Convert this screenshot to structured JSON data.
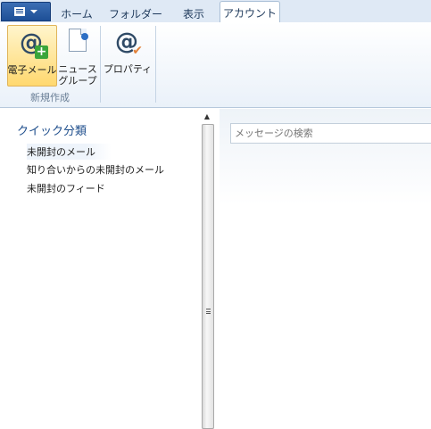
{
  "ribbon": {
    "file_menu_icon": "document-list-icon",
    "tabs": [
      {
        "label": "ホーム"
      },
      {
        "label": "フォルダー"
      },
      {
        "label": "表示"
      },
      {
        "label": "アカウント",
        "active": true
      }
    ],
    "buttons": {
      "email": {
        "label": "電子メール",
        "icon": "at-plus-icon",
        "selected": true
      },
      "newsgroup": {
        "label_line1": "ニュース",
        "label_line2": "グループ",
        "icon": "document-pin-icon"
      },
      "properties": {
        "label": "プロパティ",
        "icon": "at-check-icon"
      }
    },
    "group_label": "新規作成"
  },
  "sidebar": {
    "title": "クイック分類",
    "items": [
      {
        "label": "未開封のメール"
      },
      {
        "label": "知り合いからの未開封のメール"
      },
      {
        "label": "未開封のフィード"
      }
    ]
  },
  "search": {
    "placeholder": "メッセージの検索",
    "value": ""
  },
  "colors": {
    "accent": "#1d4f96",
    "selected_button": "#ffd86f",
    "sidebar_title": "#1e4e8c"
  }
}
